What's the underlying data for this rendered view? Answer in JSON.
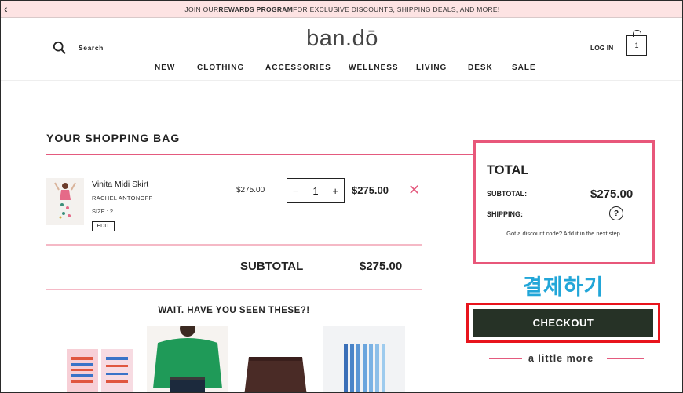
{
  "promo": {
    "prefix": "JOIN OUR ",
    "bold": "REWARDS PROGRAM",
    "suffix": " FOR EXCLUSIVE DISCOUNTS, SHIPPING DEALS, AND MORE!"
  },
  "header": {
    "search_label": "Search",
    "logo": "ban.dō",
    "login": "LOG IN",
    "bag_count": "1"
  },
  "nav": [
    "NEW",
    "CLOTHING",
    "ACCESSORIES",
    "WELLNESS",
    "LIVING",
    "DESK",
    "SALE"
  ],
  "bag": {
    "title": "YOUR SHOPPING BAG",
    "item": {
      "name": "Vinita Midi Skirt",
      "brand": "RACHEL ANTONOFF",
      "size": "SIZE : 2",
      "edit": "EDIT",
      "price": "$275.00",
      "quantity": "1",
      "total": "$275.00"
    },
    "subtotal_label": "SUBTOTAL",
    "subtotal_value": "$275.00",
    "recommend_title": "WAIT. HAVE YOU SEEN THESE?!"
  },
  "total_box": {
    "title": "TOTAL",
    "subtotal_label": "SUBTOTAL:",
    "subtotal_value": "$275.00",
    "shipping_label": "SHIPPING:",
    "discount_note": "Got a discount code? Add it in the next step."
  },
  "annotation": "결제하기",
  "checkout_label": "CHECKOUT",
  "little_more": "a little more",
  "colors": {
    "promo_bg": "#fde3e3",
    "accent_pink": "#e45a7e",
    "checkout_bg": "#263226",
    "highlight_red": "#e8141c",
    "annotation_blue": "#22a6d8"
  },
  "icons": {
    "back": "chevron-left-icon",
    "search": "search-icon",
    "bag": "shopping-bag-icon",
    "remove": "close-icon",
    "help": "question-circle-icon"
  }
}
